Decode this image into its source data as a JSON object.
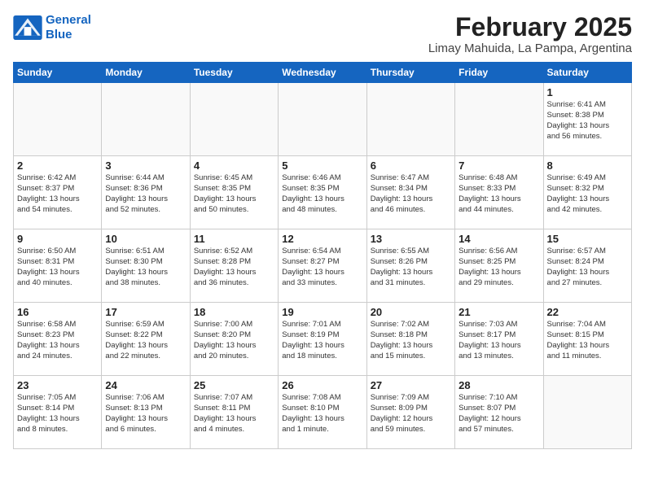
{
  "header": {
    "logo_line1": "General",
    "logo_line2": "Blue",
    "title": "February 2025",
    "subtitle": "Limay Mahuida, La Pampa, Argentina"
  },
  "days_of_week": [
    "Sunday",
    "Monday",
    "Tuesday",
    "Wednesday",
    "Thursday",
    "Friday",
    "Saturday"
  ],
  "weeks": [
    [
      {
        "day": "",
        "info": ""
      },
      {
        "day": "",
        "info": ""
      },
      {
        "day": "",
        "info": ""
      },
      {
        "day": "",
        "info": ""
      },
      {
        "day": "",
        "info": ""
      },
      {
        "day": "",
        "info": ""
      },
      {
        "day": "1",
        "info": "Sunrise: 6:41 AM\nSunset: 8:38 PM\nDaylight: 13 hours\nand 56 minutes."
      }
    ],
    [
      {
        "day": "2",
        "info": "Sunrise: 6:42 AM\nSunset: 8:37 PM\nDaylight: 13 hours\nand 54 minutes."
      },
      {
        "day": "3",
        "info": "Sunrise: 6:44 AM\nSunset: 8:36 PM\nDaylight: 13 hours\nand 52 minutes."
      },
      {
        "day": "4",
        "info": "Sunrise: 6:45 AM\nSunset: 8:35 PM\nDaylight: 13 hours\nand 50 minutes."
      },
      {
        "day": "5",
        "info": "Sunrise: 6:46 AM\nSunset: 8:35 PM\nDaylight: 13 hours\nand 48 minutes."
      },
      {
        "day": "6",
        "info": "Sunrise: 6:47 AM\nSunset: 8:34 PM\nDaylight: 13 hours\nand 46 minutes."
      },
      {
        "day": "7",
        "info": "Sunrise: 6:48 AM\nSunset: 8:33 PM\nDaylight: 13 hours\nand 44 minutes."
      },
      {
        "day": "8",
        "info": "Sunrise: 6:49 AM\nSunset: 8:32 PM\nDaylight: 13 hours\nand 42 minutes."
      }
    ],
    [
      {
        "day": "9",
        "info": "Sunrise: 6:50 AM\nSunset: 8:31 PM\nDaylight: 13 hours\nand 40 minutes."
      },
      {
        "day": "10",
        "info": "Sunrise: 6:51 AM\nSunset: 8:30 PM\nDaylight: 13 hours\nand 38 minutes."
      },
      {
        "day": "11",
        "info": "Sunrise: 6:52 AM\nSunset: 8:28 PM\nDaylight: 13 hours\nand 36 minutes."
      },
      {
        "day": "12",
        "info": "Sunrise: 6:54 AM\nSunset: 8:27 PM\nDaylight: 13 hours\nand 33 minutes."
      },
      {
        "day": "13",
        "info": "Sunrise: 6:55 AM\nSunset: 8:26 PM\nDaylight: 13 hours\nand 31 minutes."
      },
      {
        "day": "14",
        "info": "Sunrise: 6:56 AM\nSunset: 8:25 PM\nDaylight: 13 hours\nand 29 minutes."
      },
      {
        "day": "15",
        "info": "Sunrise: 6:57 AM\nSunset: 8:24 PM\nDaylight: 13 hours\nand 27 minutes."
      }
    ],
    [
      {
        "day": "16",
        "info": "Sunrise: 6:58 AM\nSunset: 8:23 PM\nDaylight: 13 hours\nand 24 minutes."
      },
      {
        "day": "17",
        "info": "Sunrise: 6:59 AM\nSunset: 8:22 PM\nDaylight: 13 hours\nand 22 minutes."
      },
      {
        "day": "18",
        "info": "Sunrise: 7:00 AM\nSunset: 8:20 PM\nDaylight: 13 hours\nand 20 minutes."
      },
      {
        "day": "19",
        "info": "Sunrise: 7:01 AM\nSunset: 8:19 PM\nDaylight: 13 hours\nand 18 minutes."
      },
      {
        "day": "20",
        "info": "Sunrise: 7:02 AM\nSunset: 8:18 PM\nDaylight: 13 hours\nand 15 minutes."
      },
      {
        "day": "21",
        "info": "Sunrise: 7:03 AM\nSunset: 8:17 PM\nDaylight: 13 hours\nand 13 minutes."
      },
      {
        "day": "22",
        "info": "Sunrise: 7:04 AM\nSunset: 8:15 PM\nDaylight: 13 hours\nand 11 minutes."
      }
    ],
    [
      {
        "day": "23",
        "info": "Sunrise: 7:05 AM\nSunset: 8:14 PM\nDaylight: 13 hours\nand 8 minutes."
      },
      {
        "day": "24",
        "info": "Sunrise: 7:06 AM\nSunset: 8:13 PM\nDaylight: 13 hours\nand 6 minutes."
      },
      {
        "day": "25",
        "info": "Sunrise: 7:07 AM\nSunset: 8:11 PM\nDaylight: 13 hours\nand 4 minutes."
      },
      {
        "day": "26",
        "info": "Sunrise: 7:08 AM\nSunset: 8:10 PM\nDaylight: 13 hours\nand 1 minute."
      },
      {
        "day": "27",
        "info": "Sunrise: 7:09 AM\nSunset: 8:09 PM\nDaylight: 12 hours\nand 59 minutes."
      },
      {
        "day": "28",
        "info": "Sunrise: 7:10 AM\nSunset: 8:07 PM\nDaylight: 12 hours\nand 57 minutes."
      },
      {
        "day": "",
        "info": ""
      }
    ]
  ]
}
